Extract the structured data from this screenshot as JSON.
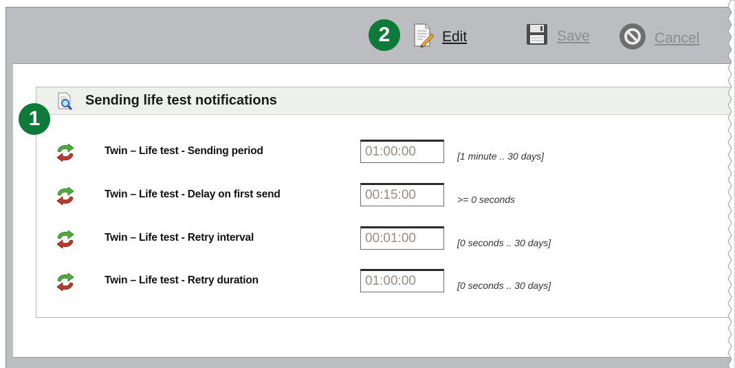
{
  "toolbar": {
    "step_badge": "2",
    "edit_label": "Edit",
    "save_label": "Save",
    "cancel_label": "Cancel",
    "icons": {
      "edit": "edit-document-icon",
      "save": "floppy-disk-icon",
      "cancel": "cancel-circle-icon"
    }
  },
  "section": {
    "step_badge": "1",
    "title": "Sending life test notifications",
    "header_icon": "search-document-icon"
  },
  "rows": [
    {
      "label": "Twin – Life test - Sending period",
      "value": "01:00:00",
      "hint": "[1 minute .. 30 days]",
      "icon": "refresh-arrows-icon"
    },
    {
      "label": "Twin – Life test - Delay on first send",
      "value": "00:15:00",
      "hint": ">= 0 seconds",
      "icon": "refresh-arrows-icon"
    },
    {
      "label": "Twin – Life test - Retry interval",
      "value": "00:01:00",
      "hint": "[0 seconds .. 30 days]",
      "icon": "refresh-arrows-icon"
    },
    {
      "label": "Twin – Life test - Retry duration",
      "value": "01:00:00",
      "hint": "[0 seconds .. 30 days]",
      "icon": "refresh-arrows-icon"
    }
  ],
  "colors": {
    "badge": "#0e7a3a",
    "toolbar_bg": "#bcbdc0",
    "header_bg": "#eef0ee"
  }
}
